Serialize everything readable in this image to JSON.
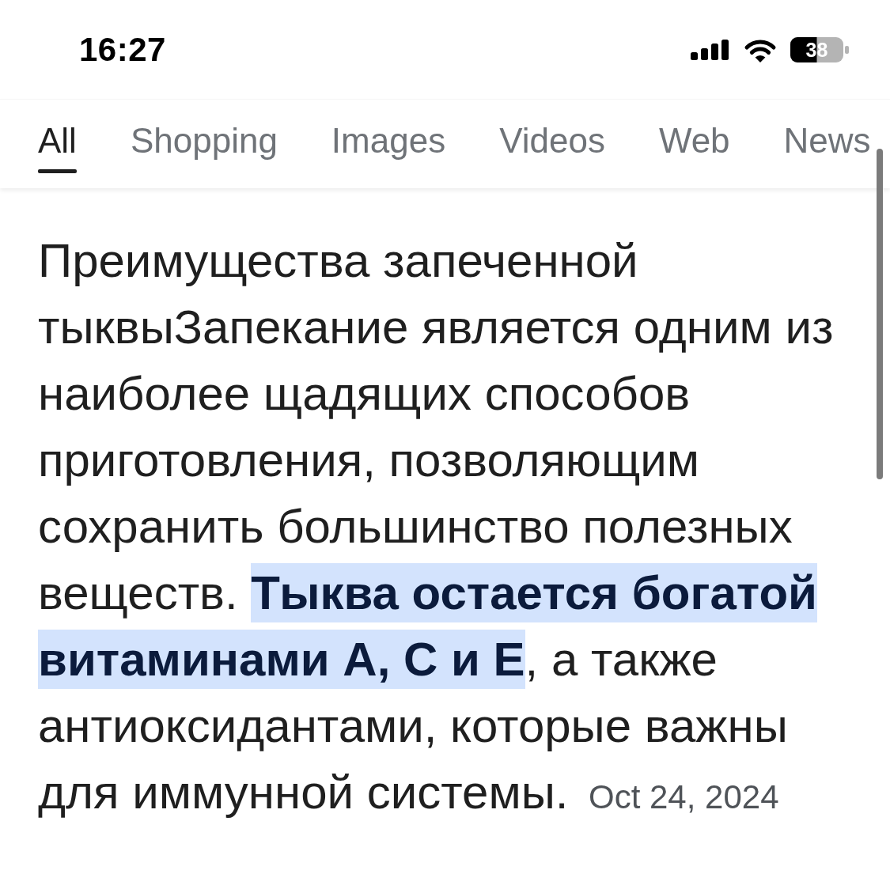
{
  "status_bar": {
    "time": "16:27",
    "battery": "38"
  },
  "tabs": [
    {
      "label": "All",
      "selected": true
    },
    {
      "label": "Shopping",
      "selected": false
    },
    {
      "label": "Images",
      "selected": false
    },
    {
      "label": "Videos",
      "selected": false
    },
    {
      "label": "Web",
      "selected": false
    },
    {
      "label": "News",
      "selected": false
    }
  ],
  "snippet": {
    "text": "Преимущества запеченной тыквыЗапекание является одним из наиболее щадящих способов приготовления, позволяющим сохранить большинство полезных веществ. **Тыква остается богатой витаминами А, С и Е**, а также антиоксидантами, которые важны для иммунной системы.",
    "date": "Oct 24, 2024"
  }
}
